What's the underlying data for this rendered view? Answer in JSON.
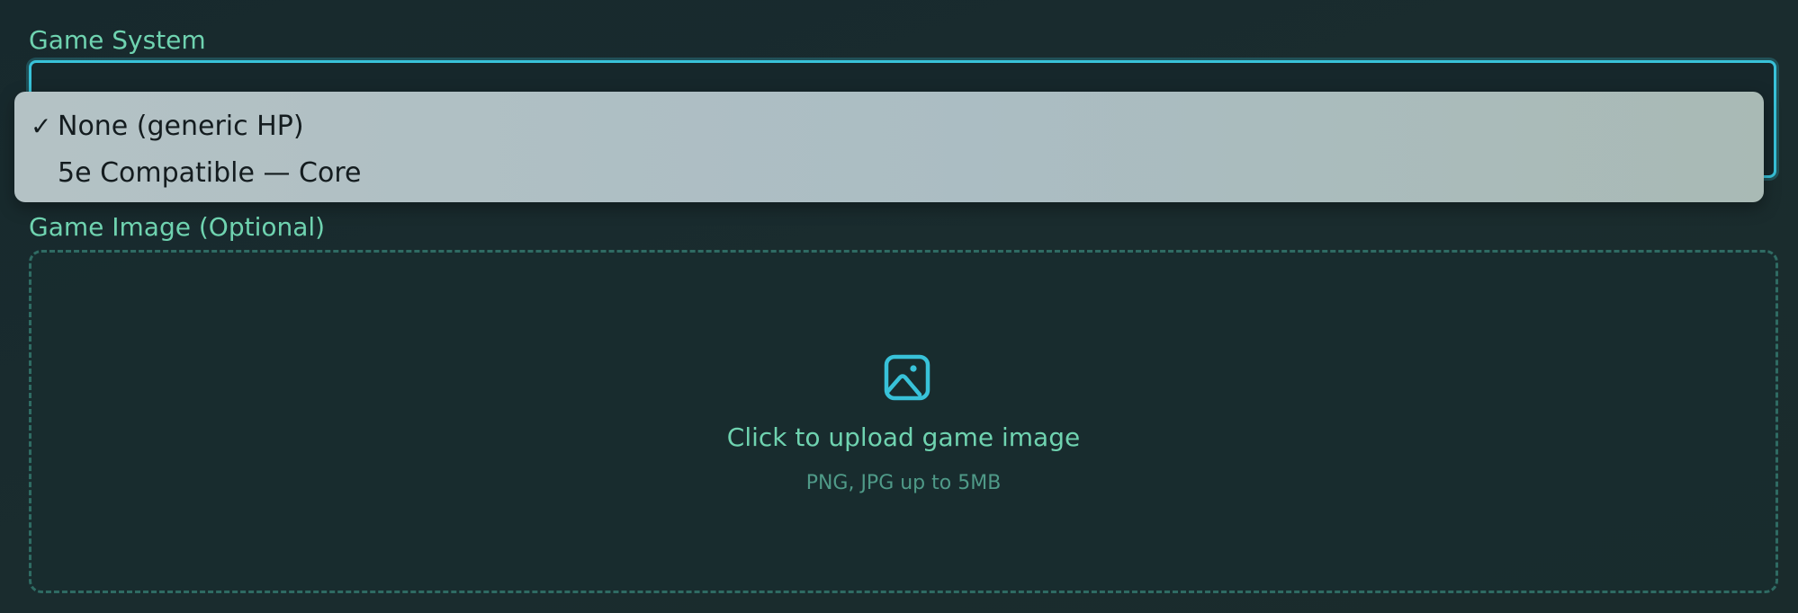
{
  "game_system": {
    "label": "Game System",
    "options": [
      {
        "label": "None (generic HP)",
        "selected": true,
        "check": "✓"
      },
      {
        "label": "5e Compatible — Core",
        "selected": false,
        "check": ""
      }
    ]
  },
  "game_image": {
    "label": "Game Image (Optional)",
    "upload_title": "Click to upload game image",
    "upload_hint": "PNG, JPG up to 5MB",
    "icon": "image-icon"
  },
  "colors": {
    "accent": "#38c2d9",
    "label_green": "#6fd3b0",
    "hint_green": "#4f9a88",
    "background": "#17292d",
    "dropdown_bg": "#b0c0c3"
  }
}
